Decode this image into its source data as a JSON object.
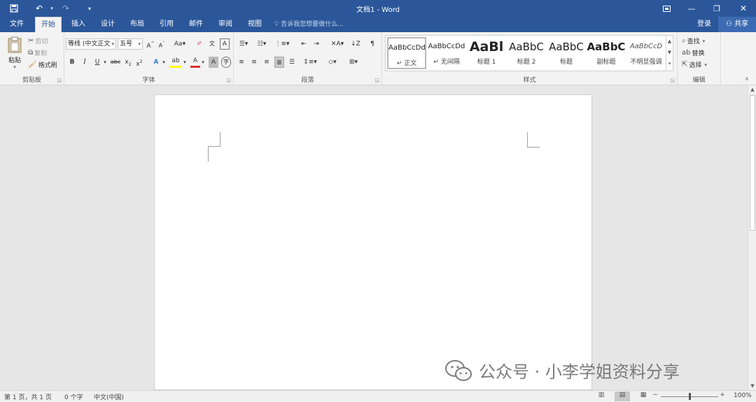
{
  "titlebar": {
    "title": "文档1 - Word",
    "qa_icons": [
      "save-icon",
      "undo-icon",
      "redo-icon",
      "customize-qat-icon"
    ],
    "bg": "#2b579a"
  },
  "tabs": [
    {
      "label": "文件"
    },
    {
      "label": "开始"
    },
    {
      "label": "插入"
    },
    {
      "label": "设计"
    },
    {
      "label": "布局"
    },
    {
      "label": "引用"
    },
    {
      "label": "邮件"
    },
    {
      "label": "审阅"
    },
    {
      "label": "视图"
    }
  ],
  "tellme": "告诉我您想要做什么...",
  "account": {
    "login": "登录",
    "share": "共享"
  },
  "clipboard": {
    "paste": "粘贴",
    "cut": "剪切",
    "copy": "复制",
    "format_painter": "格式刷",
    "label": "剪贴板"
  },
  "font": {
    "name": "等线 (中文正文",
    "size": "五号",
    "label": "字体"
  },
  "paragraph": {
    "label": "段落"
  },
  "styles": {
    "label": "样式",
    "items": [
      {
        "preview": "AaBbCcDd",
        "name": "↵ 正文"
      },
      {
        "preview": "AaBbCcDd",
        "name": "↵ 无间隔"
      },
      {
        "preview": "AaBl",
        "name": "标题 1"
      },
      {
        "preview": "AaBbC",
        "name": "标题 2"
      },
      {
        "preview": "AaBbC",
        "name": "标题"
      },
      {
        "preview": "AaBbC",
        "name": "副标题"
      },
      {
        "preview": "AaBbCcD",
        "name": "不明显强调"
      }
    ]
  },
  "editing": {
    "find": "查找",
    "replace": "替换",
    "select": "选择",
    "label": "编辑"
  },
  "watermark": {
    "text": "公众号 · 小李学姐资料分享"
  },
  "status": {
    "page": "第 1 页，共 1 页",
    "words": "0 个字",
    "language": "中文(中国)",
    "zoom": "100%"
  }
}
